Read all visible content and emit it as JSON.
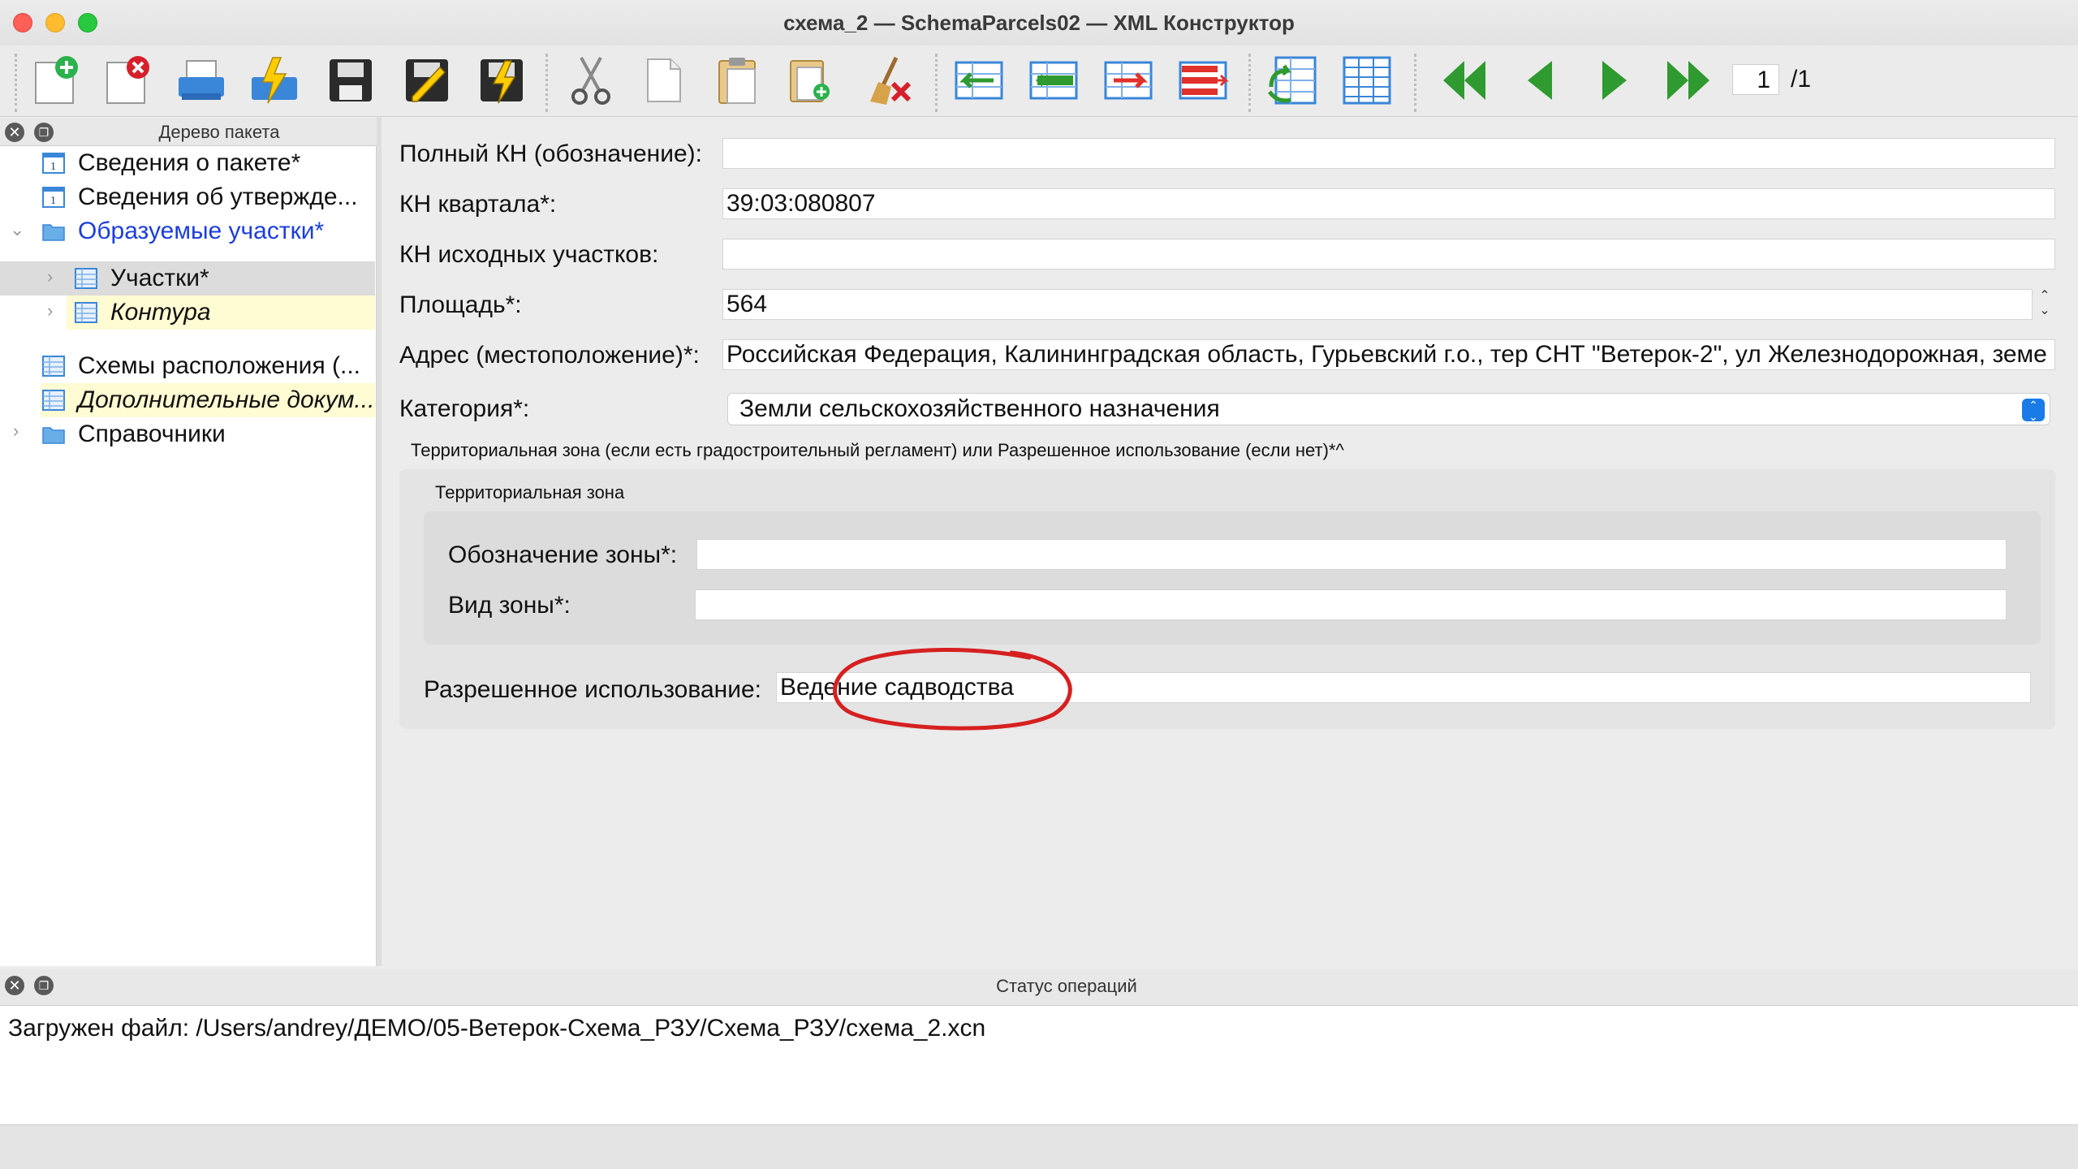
{
  "window": {
    "title": "схема_2 — SchemaParcels02 — XML Конструктор"
  },
  "toolbar": {
    "buttons": [
      "new-document-icon",
      "delete-document-icon",
      "print-icon",
      "quick-export-icon",
      "save-icon",
      "edit-save-icon",
      "fast-save-icon",
      "cut-icon",
      "copy-icon",
      "paste-icon",
      "paste-new-icon",
      "clear-icon",
      "insert-row-left-icon",
      "insert-row-middle-icon",
      "insert-row-right-icon",
      "delete-row-icon",
      "refresh-table-icon",
      "table-view-icon",
      "first-page-icon",
      "prev-page-icon",
      "next-page-icon",
      "last-page-icon"
    ],
    "page_current": "1",
    "page_total": "/1",
    "colors": {
      "green_nav": "#2f9a2f",
      "blue_doc": "#3a86d8"
    }
  },
  "tree_panel": {
    "title": "Дерево пакета",
    "items": [
      {
        "label": "Сведения о пакете*",
        "icon": "info-doc-icon"
      },
      {
        "label": "Сведения об утвержде...",
        "icon": "info-doc-icon"
      },
      {
        "label": "Образуемые участки*",
        "icon": "folder-icon",
        "expanded": true
      },
      {
        "label": "Участки*",
        "icon": "table-icon"
      },
      {
        "label": "Контура",
        "icon": "table-icon"
      },
      {
        "label": "Схемы расположения (...",
        "icon": "table-icon"
      },
      {
        "label": "Дополнительные докум...",
        "icon": "table-icon"
      },
      {
        "label": "Справочники",
        "icon": "folder-icon"
      }
    ]
  },
  "form": {
    "full_kn_label": "Полный КН (обозначение):",
    "full_kn_value": "",
    "kvartal_label": "КН квартала*:",
    "kvartal_value": "39:03:080807",
    "source_label": "КН исходных участков:",
    "source_value": "",
    "area_label": "Площадь*:",
    "area_value": "564",
    "address_label": "Адрес (местоположение)*:",
    "address_value": "Российская Федерация, Калининградская область, Гурьевский г.о., тер СНТ \"Ветерок-2\", ул Железнодорожная, земе",
    "category_label": "Категория*:",
    "category_value": "Земли сельскохозяйственного назначения",
    "zone_group_label": "Территориальная зона (если есть градостроительный регламент) или Разрешенное использование (если нет)*^",
    "zone_subgroup_label": "Территориальная зона",
    "zone_code_label": "Обозначение зоны*:",
    "zone_code_value": "",
    "zone_type_label": "Вид зоны*:",
    "zone_type_value": "",
    "permitted_label": "Разрешенное использование:",
    "permitted_value": "Ведение садводства",
    "annotation_color": "#d62020"
  },
  "status_panel": {
    "title": "Статус операций",
    "message": "Загружен файл: /Users/andrey/ДЕМО/05-Ветерок-Схема_РЗУ/Схема_РЗУ/схема_2.xcn"
  }
}
